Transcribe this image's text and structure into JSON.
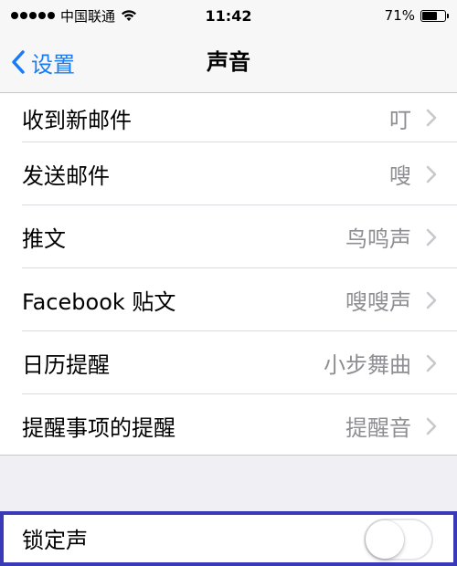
{
  "status_bar": {
    "carrier": "中国联通",
    "time": "11:42",
    "battery_percent": "71%",
    "battery_level": 0.71,
    "wifi_icon": "wifi-icon",
    "signal_icon": "signal-dots-icon"
  },
  "nav": {
    "back_label": "设置",
    "title": "声音"
  },
  "rows": [
    {
      "label": "收到新邮件",
      "value": "叮"
    },
    {
      "label": "发送邮件",
      "value": "嗖"
    },
    {
      "label": "推文",
      "value": "鸟鸣声"
    },
    {
      "label": "Facebook 贴文",
      "value": "嗖嗖声"
    },
    {
      "label": "日历提醒",
      "value": "小步舞曲"
    },
    {
      "label": "提醒事项的提醒",
      "value": "提醒音"
    }
  ],
  "lock_sound": {
    "label": "锁定声",
    "enabled": false
  },
  "colors": {
    "accent": "#1a7cf5",
    "highlight_border": "#3a3ab8"
  }
}
